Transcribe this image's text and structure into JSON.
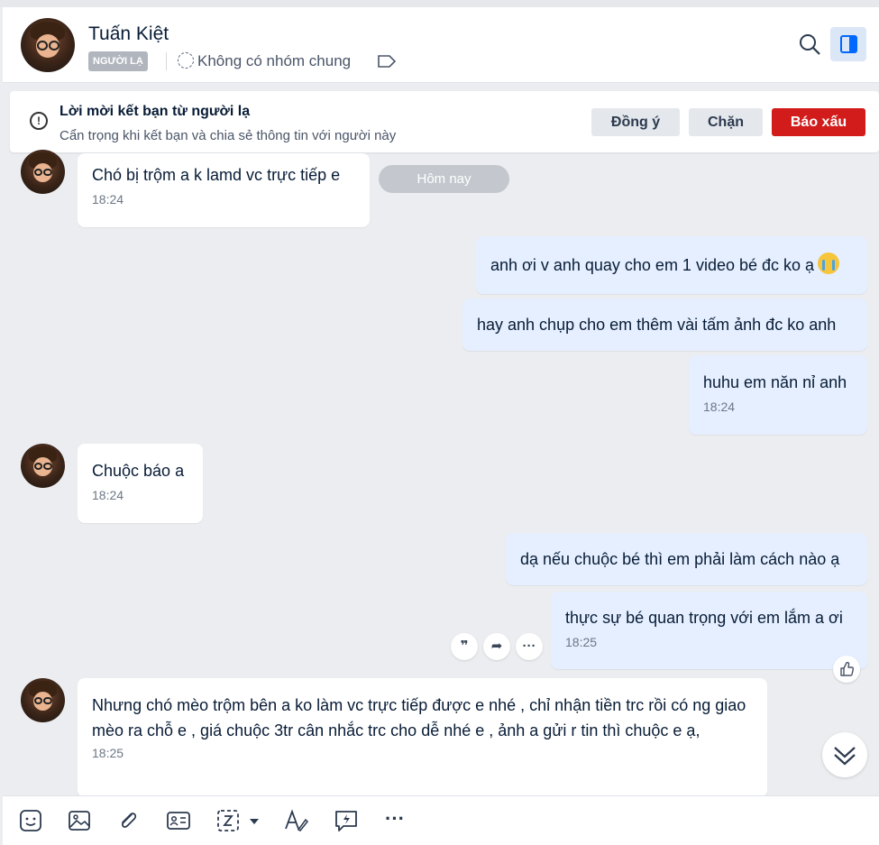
{
  "header": {
    "contact_name": "Tuấn Kiệt",
    "badge": "NGƯỜI LẠ",
    "group_text": "Không có nhóm chung"
  },
  "friend_request": {
    "title": "Lời mời kết bạn từ người lạ",
    "subtitle": "Cẩn trọng khi kết bạn và chia sẻ thông tin với người này",
    "accept_label": "Đồng ý",
    "block_label": "Chặn",
    "report_label": "Báo xấu",
    "info_glyph": "!"
  },
  "day_divider": "Hôm nay",
  "messages": [
    {
      "side": "in",
      "text": "Chó bị trộm a k lamd vc trực tiếp e",
      "time": "18:24"
    },
    {
      "side": "out",
      "text": "anh ơi v anh quay cho em 1 video bé đc ko ạ",
      "emoji": "crying-face-icon"
    },
    {
      "side": "out",
      "text": "hay anh chụp cho em thêm vài tấm ảnh đc ko anh"
    },
    {
      "side": "out",
      "text": "huhu em năn nỉ anh",
      "time": "18:24"
    },
    {
      "side": "in",
      "text": "Chuộc báo a",
      "time": "18:24"
    },
    {
      "side": "out",
      "text": "dạ nếu chuộc bé thì em phải làm cách nào ạ"
    },
    {
      "side": "out",
      "text": "thực sự bé quan trọng với em lắm a ơi",
      "time": "18:25"
    },
    {
      "side": "in",
      "text": "Nhưng chó mèo trộm bên a ko làm vc trực tiếp được e nhé , chỉ nhận tiền trc rồi có ng giao mèo ra chỗ e , giá chuộc 3tr cân nhắc trc cho dễ nhé e , ảnh a gửi r tin thì chuộc e ạ,",
      "time": "18:25"
    }
  ],
  "hover_actions": {
    "quote_glyph": "❞",
    "forward_glyph": "➦",
    "more_glyph": "···"
  },
  "toolbar_icons": [
    "sticker-icon",
    "image-icon",
    "attachment-icon",
    "contact-card-icon",
    "screenshot-icon",
    "text-format-icon",
    "quick-message-icon",
    "more-icon"
  ],
  "toolbar_more_glyph": "···",
  "colors": {
    "accent": "#0068ff",
    "report": "#d21b1b",
    "outgoing_bubble": "#e5efff"
  }
}
